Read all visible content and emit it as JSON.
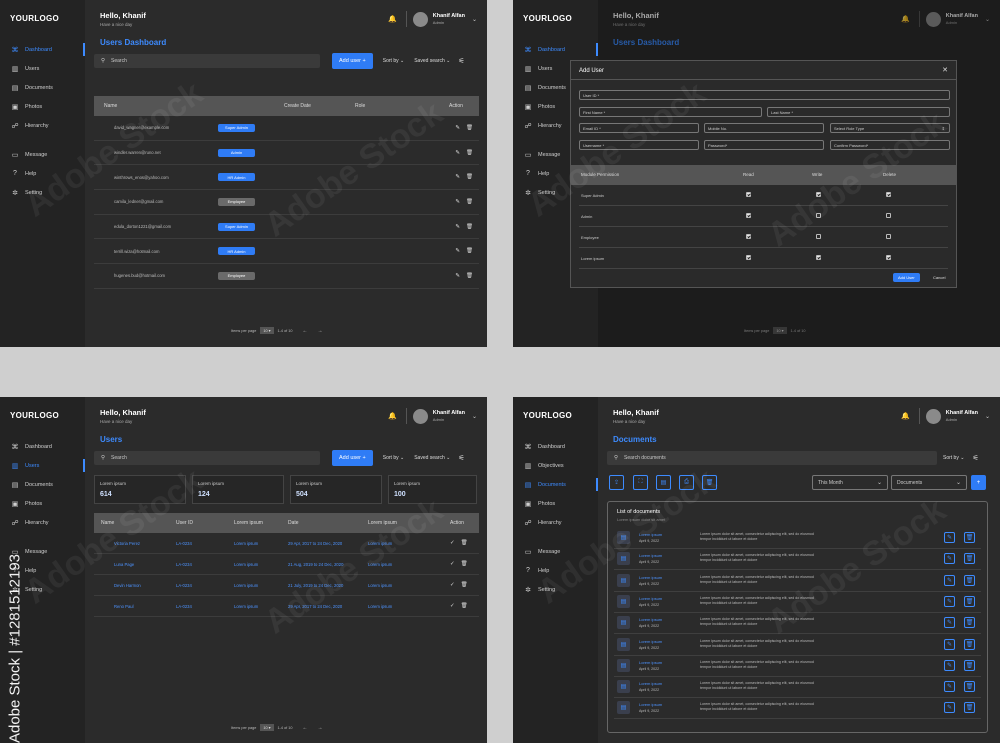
{
  "brand": {
    "logo": "YOURLOGO",
    "accent": "#3d8bff"
  },
  "header": {
    "greeting": "Hello, Khanif",
    "subtitle": "Have a nice day",
    "user_name": "Khanif Alfan",
    "user_role": "Admin"
  },
  "nav_main": [
    {
      "label": "Dashboard",
      "icon": "dashboard-icon"
    },
    {
      "label": "Users",
      "icon": "chart-icon"
    },
    {
      "label": "Documents",
      "icon": "document-icon"
    },
    {
      "label": "Photos",
      "icon": "photo-icon"
    },
    {
      "label": "Hierarchy",
      "icon": "hierarchy-icon"
    }
  ],
  "nav_objectives": {
    "label": "Objectives"
  },
  "nav_secondary": [
    {
      "label": "Message",
      "icon": "message-icon"
    },
    {
      "label": "Help",
      "icon": "help-icon"
    },
    {
      "label": "Setting",
      "icon": "gear-icon"
    }
  ],
  "toolbar": {
    "search_placeholder": "Search",
    "add_user": "Add user +",
    "sort_by": "Sort by",
    "saved_search": "Saved search"
  },
  "dashboard": {
    "title": "Users Dashboard",
    "columns": [
      "Name",
      "Create Date",
      "Role",
      "Action"
    ],
    "rows": [
      {
        "email": "david_wagner@example.com",
        "role": "Super Admin",
        "blue": true
      },
      {
        "email": "windler.warren@runo.net",
        "role": "Admin",
        "blue": true
      },
      {
        "email": "winthrows_enos@yahoo.com",
        "role": "HR Admin",
        "blue": true
      },
      {
        "email": "camila_ledner@gmail.com",
        "role": "Employee",
        "blue": false
      },
      {
        "email": "edula_dorton1221@gmail.com",
        "role": "Super Admin",
        "blue": true
      },
      {
        "email": "terrill.wiza@hotmail.com",
        "role": "HR Admin",
        "blue": true
      },
      {
        "email": "hugenes.bud@hotmail.com",
        "role": "Employee",
        "blue": false
      }
    ],
    "pager": {
      "label": "Items per page",
      "value": "10",
      "range": "1-4 of 10"
    }
  },
  "modal": {
    "title": "Add User",
    "fields": {
      "user_id": "User ID *",
      "first_name": "First Name *",
      "last_name": "Last Name *",
      "email": "Email ID *",
      "mobile": "Mobile No.",
      "role": "Select Role Type",
      "username": "Username *",
      "password": "Password*",
      "confirm": "Confirm Password*"
    },
    "perm_columns": [
      "Module Permission",
      "Read",
      "Write",
      "Delete"
    ],
    "perms": [
      {
        "name": "Super Admin",
        "read": true,
        "write": true,
        "del": true
      },
      {
        "name": "Admin",
        "read": true,
        "write": false,
        "del": false
      },
      {
        "name": "Employee",
        "read": true,
        "write": false,
        "del": false
      },
      {
        "name": "Lorem ipsum",
        "read": true,
        "write": true,
        "del": true
      }
    ],
    "add_btn": "Add User",
    "cancel_btn": "Cancel"
  },
  "users": {
    "title": "Users",
    "stats": [
      {
        "label": "Lorem ipsum",
        "value": "614"
      },
      {
        "label": "Lorem ipsum",
        "value": "124"
      },
      {
        "label": "Lorem ipsum",
        "value": "504"
      },
      {
        "label": "Lorem ipsum",
        "value": "100"
      }
    ],
    "columns": [
      "Name",
      "User ID",
      "Lorem ipsum",
      "Date",
      "Lorem ipsum",
      "Action"
    ],
    "rows": [
      {
        "name": "Victoria Perez",
        "id": "LA-0234",
        "c3": "Lorem ipsum",
        "date": "29 Apr, 2017 to 24 Dec, 2020",
        "c5": "Lorem ipsum"
      },
      {
        "name": "Luna Page",
        "id": "LA-0234",
        "c3": "Lorem ipsum",
        "date": "21 Aug, 2019 to 24 Dec, 2020",
        "c5": "Lorem ipsum"
      },
      {
        "name": "Devin Harmon",
        "id": "LA-0234",
        "c3": "Lorem ipsum",
        "date": "21 July, 2019 to 24 Dec, 2020",
        "c5": "Lorem ipsum"
      },
      {
        "name": "Reno Paul",
        "id": "LA-0234",
        "c3": "Lorem ipsum",
        "date": "29 Apr, 2017 to 24 Dec, 2020",
        "c5": "Lorem ipsum"
      }
    ]
  },
  "documents": {
    "title": "Documents",
    "search_placeholder": "Search documents",
    "sort_by": "Sort by",
    "month_filter": "This Month",
    "type_filter": "Documents",
    "list_title": "List of documents",
    "list_sub": "Lorem ipsum dolor sit amet",
    "items": [
      {
        "name": "Lorem ipsum",
        "date": "April 9, 2022",
        "text": "Lorem ipsum dolor sit amet, consectetur adipiscing elit, sed do eiusmod tempor incididunt ut labore et dolore"
      },
      {
        "name": "Lorem ipsum",
        "date": "April 9, 2022",
        "text": "Lorem ipsum dolor sit amet, consectetur adipiscing elit, sed do eiusmod tempor incididunt ut labore et dolore"
      },
      {
        "name": "Lorem ipsum",
        "date": "April 9, 2022",
        "text": "Lorem ipsum dolor sit amet, consectetur adipiscing elit, sed do eiusmod tempor incididunt ut labore et dolore"
      },
      {
        "name": "Lorem ipsum",
        "date": "April 9, 2022",
        "text": "Lorem ipsum dolor sit amet, consectetur adipiscing elit, sed do eiusmod tempor incididunt ut labore et dolore"
      },
      {
        "name": "Lorem ipsum",
        "date": "April 9, 2022",
        "text": "Lorem ipsum dolor sit amet, consectetur adipiscing elit, sed do eiusmod tempor incididunt ut labore et dolore"
      },
      {
        "name": "Lorem ipsum",
        "date": "April 9, 2022",
        "text": "Lorem ipsum dolor sit amet, consectetur adipiscing elit, sed do eiusmod tempor incididunt ut labore et dolore"
      },
      {
        "name": "Lorem ipsum",
        "date": "April 9, 2022",
        "text": "Lorem ipsum dolor sit amet, consectetur adipiscing elit, sed do eiusmod tempor incididunt ut labore et dolore"
      },
      {
        "name": "Lorem ipsum",
        "date": "April 9, 2022",
        "text": "Lorem ipsum dolor sit amet, consectetur adipiscing elit, sed do eiusmod tempor incididunt ut labore et dolore"
      },
      {
        "name": "Lorem ipsum",
        "date": "April 9, 2022",
        "text": "Lorem ipsum dolor sit amet, consectetur adipiscing elit, sed do eiusmod tempor incididunt ut labore et dolore"
      }
    ]
  },
  "watermark": {
    "text": "Adobe Stock",
    "id": "Adobe Stock | #1281512193"
  }
}
